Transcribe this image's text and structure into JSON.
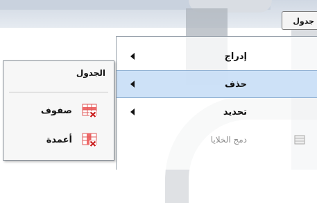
{
  "tab": {
    "label": "جدول"
  },
  "menu": {
    "items": [
      {
        "label": "إدراج",
        "icon": "chevron-left-icon"
      },
      {
        "label": "حذف",
        "icon": "chevron-left-icon",
        "highlighted": true
      },
      {
        "label": "تحديد",
        "icon": "chevron-left-icon"
      },
      {
        "label": "دمج الخلايا",
        "icon": "merge-cells-icon",
        "disabled": true
      }
    ]
  },
  "submenu": {
    "title": "الجدول",
    "items": [
      {
        "label": "صفوف",
        "icon": "delete-rows-icon"
      },
      {
        "label": "أعمدة",
        "icon": "delete-columns-icon"
      }
    ]
  },
  "colors": {
    "highlight": "#c8def6",
    "delete_red": "#d42020",
    "grid_red": "#e04a4a"
  }
}
